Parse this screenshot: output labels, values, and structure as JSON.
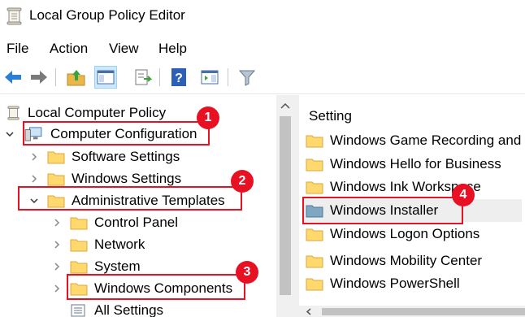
{
  "window": {
    "title": "Local Group Policy Editor",
    "icon": "policy-scroll-icon"
  },
  "menu": {
    "items": [
      "File",
      "Action",
      "View",
      "Help"
    ]
  },
  "toolbar": {
    "buttons": [
      "back-arrow-icon",
      "forward-arrow-icon",
      "up-folder-icon",
      "show-hide-tree-icon",
      "export-list-icon",
      "help-icon",
      "properties-pane-icon",
      "filter-icon"
    ]
  },
  "tree": {
    "root": "Local Computer Policy",
    "computer_configuration": "Computer Configuration",
    "software_settings": "Software Settings",
    "windows_settings": "Windows Settings",
    "administrative_templates": "Administrative Templates",
    "control_panel": "Control Panel",
    "network": "Network",
    "system": "System",
    "windows_components": "Windows Components",
    "all_settings": "All Settings"
  },
  "list": {
    "header": "Setting",
    "items": [
      "Windows Game Recording and",
      "Windows Hello for Business",
      "Windows Ink Workspace",
      "Windows Installer",
      "Windows Logon Options",
      "Windows Mobility Center",
      "Windows PowerShell"
    ],
    "selected": "Windows Installer"
  },
  "callouts": [
    "1",
    "2",
    "3",
    "4"
  ],
  "colors": {
    "callout": "#e81123",
    "folder": "#ffd86e",
    "selection": "#eeeeee",
    "scrollbar": "#c2c2c2"
  }
}
